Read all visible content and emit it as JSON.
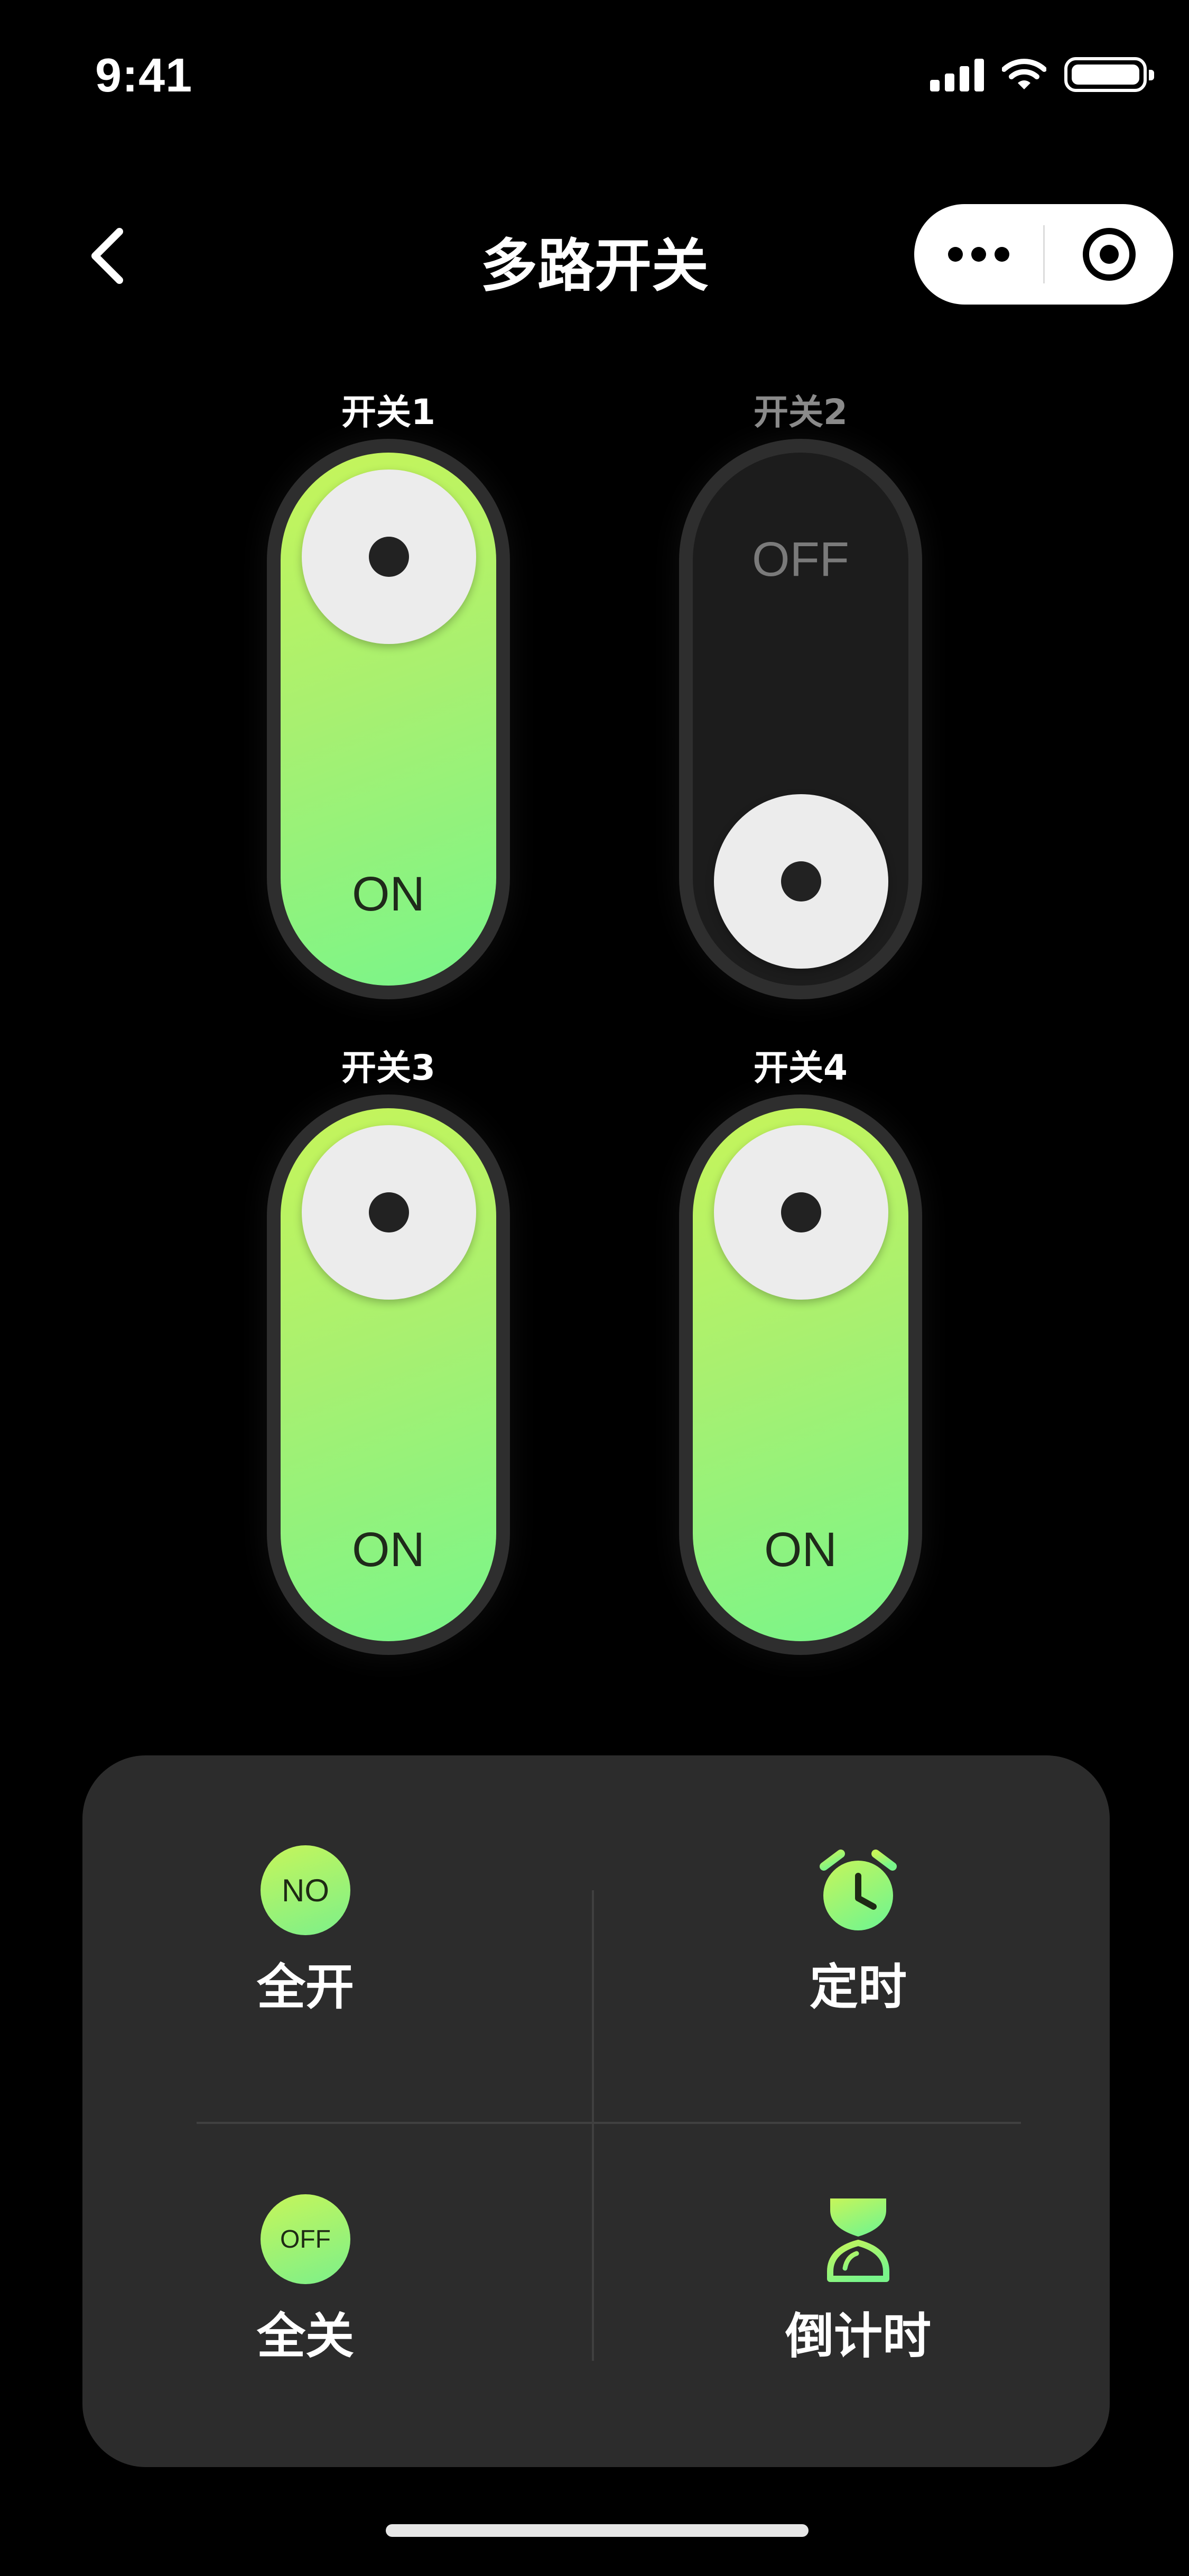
{
  "status_bar": {
    "time": "9:41"
  },
  "nav": {
    "title": "多路开关"
  },
  "switches": [
    {
      "label": "开关1",
      "state": "ON",
      "on": true
    },
    {
      "label": "开关2",
      "state": "OFF",
      "on": false
    },
    {
      "label": "开关3",
      "state": "ON",
      "on": true
    },
    {
      "label": "开关4",
      "state": "ON",
      "on": true
    }
  ],
  "actions": {
    "all_on": {
      "label": "全开",
      "icon_text": "NO"
    },
    "timer": {
      "label": "定时",
      "icon": "alarm-clock-icon"
    },
    "all_off": {
      "label": "全关",
      "icon_text": "OFF"
    },
    "countdown": {
      "label": "倒计时",
      "icon": "hourglass-icon"
    }
  },
  "colors": {
    "accent_start": "#c6f55a",
    "accent_end": "#79f58a",
    "background": "#000000",
    "panel": "#2c2c2c"
  }
}
